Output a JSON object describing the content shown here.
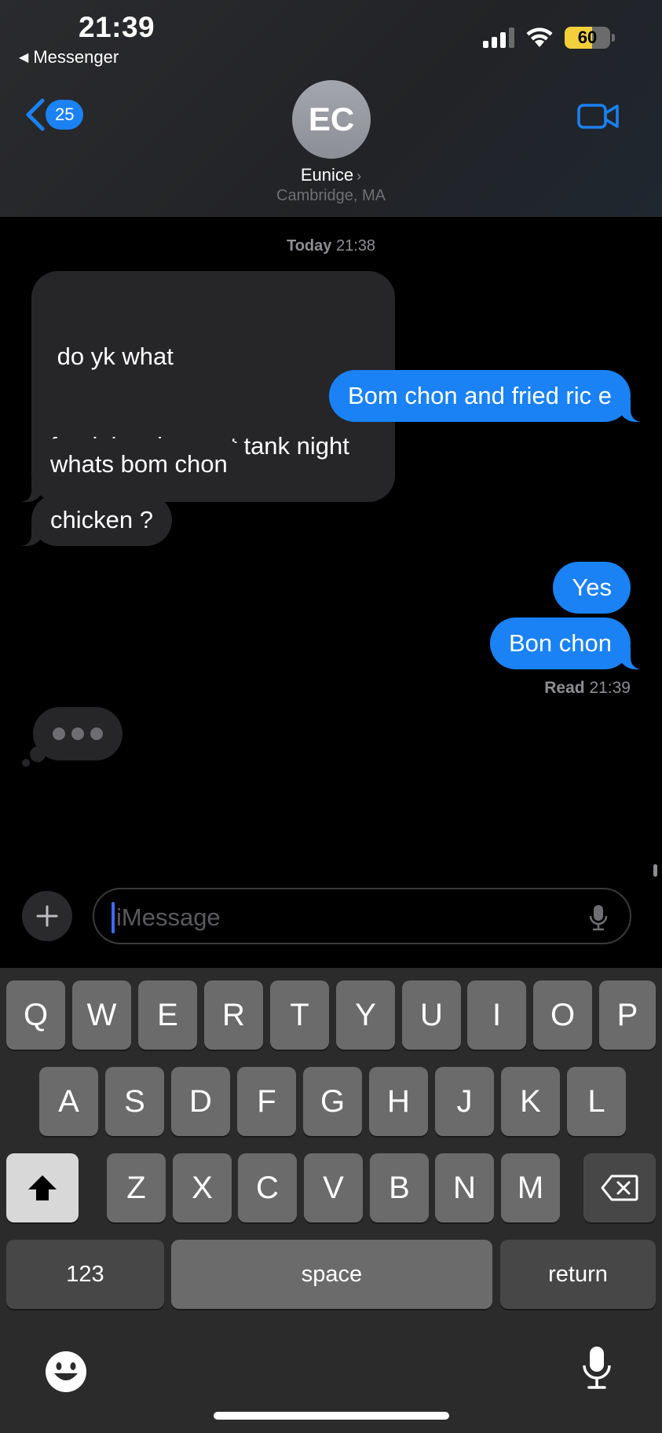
{
  "status": {
    "time": "21:39",
    "back_app": "Messenger",
    "battery": "60",
    "battery_level": 0.6
  },
  "header": {
    "unread_count": "25",
    "avatar_initials": "EC",
    "contact_name": "Eunice",
    "contact_location": "Cambridge, MA"
  },
  "chat": {
    "timestamp_day": "Today",
    "timestamp_time": "21:38",
    "messages": [
      {
        "from": "them",
        "line1": " do yk what",
        "line2": "food they have at tank night"
      },
      {
        "from": "me",
        "text": "Bom chon and fried ric e"
      },
      {
        "from": "them",
        "text": "whats bom chon"
      },
      {
        "from": "them",
        "text": "chicken ?"
      },
      {
        "from": "me",
        "text": "Yes"
      },
      {
        "from": "me",
        "text": "Bon chon"
      }
    ],
    "read_label": "Read",
    "read_time": "21:39"
  },
  "input": {
    "placeholder": "iMessage"
  },
  "keyboard": {
    "row1": [
      "Q",
      "W",
      "E",
      "R",
      "T",
      "Y",
      "U",
      "I",
      "O",
      "P"
    ],
    "row2": [
      "A",
      "S",
      "D",
      "F",
      "G",
      "H",
      "J",
      "K",
      "L"
    ],
    "row3": [
      "Z",
      "X",
      "C",
      "V",
      "B",
      "N",
      "M"
    ],
    "numbers_label": "123",
    "space_label": "space",
    "return_label": "return"
  },
  "colors": {
    "accent": "#1a82f5",
    "incoming_bubble": "#262629",
    "battery": "#f2cf3b"
  }
}
